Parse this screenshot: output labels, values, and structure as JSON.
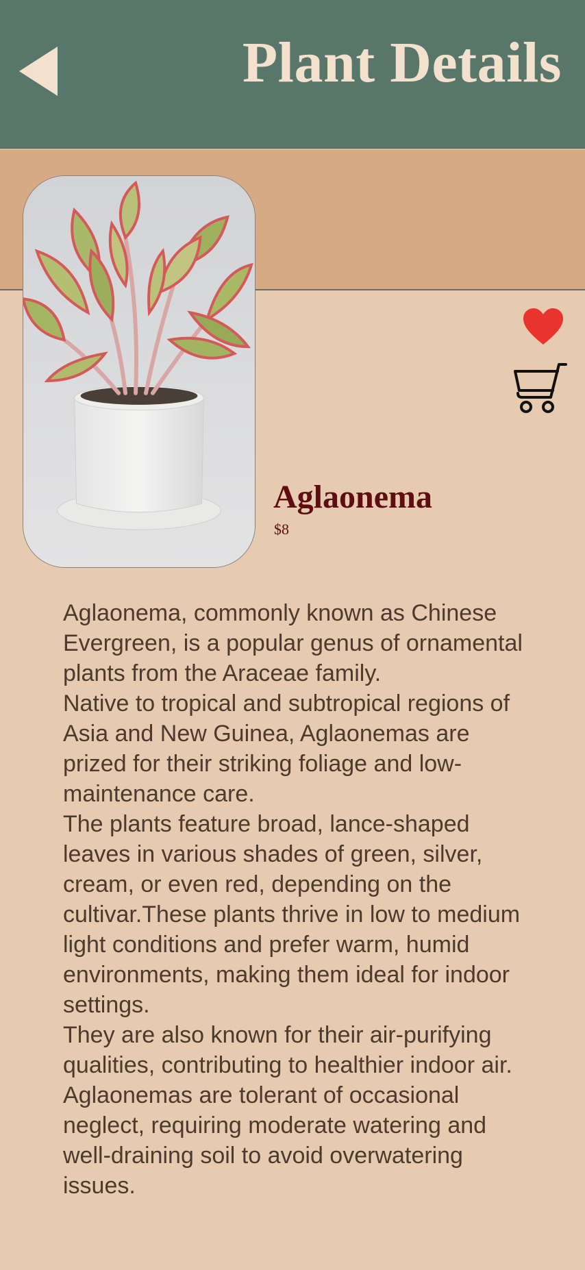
{
  "header": {
    "title": "Plant Details",
    "back_icon": "back-arrow-icon",
    "background_color": "#58776a",
    "title_color": "#f2e1cd"
  },
  "band_color": "#d6ab83",
  "page_background": "#e6cbb0",
  "actions": {
    "favorite_icon": "heart-icon",
    "favorite_color": "#e8342c",
    "cart_icon": "shopping-cart-icon"
  },
  "plant": {
    "name": "Aglaonema",
    "price": "$8",
    "image": "aglaonema-photo"
  },
  "description": [
    "Aglaonema, commonly known as Chinese Evergreen, is a popular genus of ornamental plants from the Araceae family.",
    "Native to tropical and subtropical regions of Asia and New Guinea, Aglaonemas are prized for their striking foliage and low-maintenance care.",
    "The plants feature broad, lance-shaped leaves in various shades of green, silver, cream, or even red, depending on the cultivar.These plants thrive in low to medium light conditions and prefer warm, humid environments, making them ideal for indoor settings.",
    "They are also known for their air-purifying qualities, contributing to healthier indoor air. Aglaonemas are tolerant of occasional neglect, requiring moderate watering and well-draining soil to avoid overwatering issues."
  ]
}
